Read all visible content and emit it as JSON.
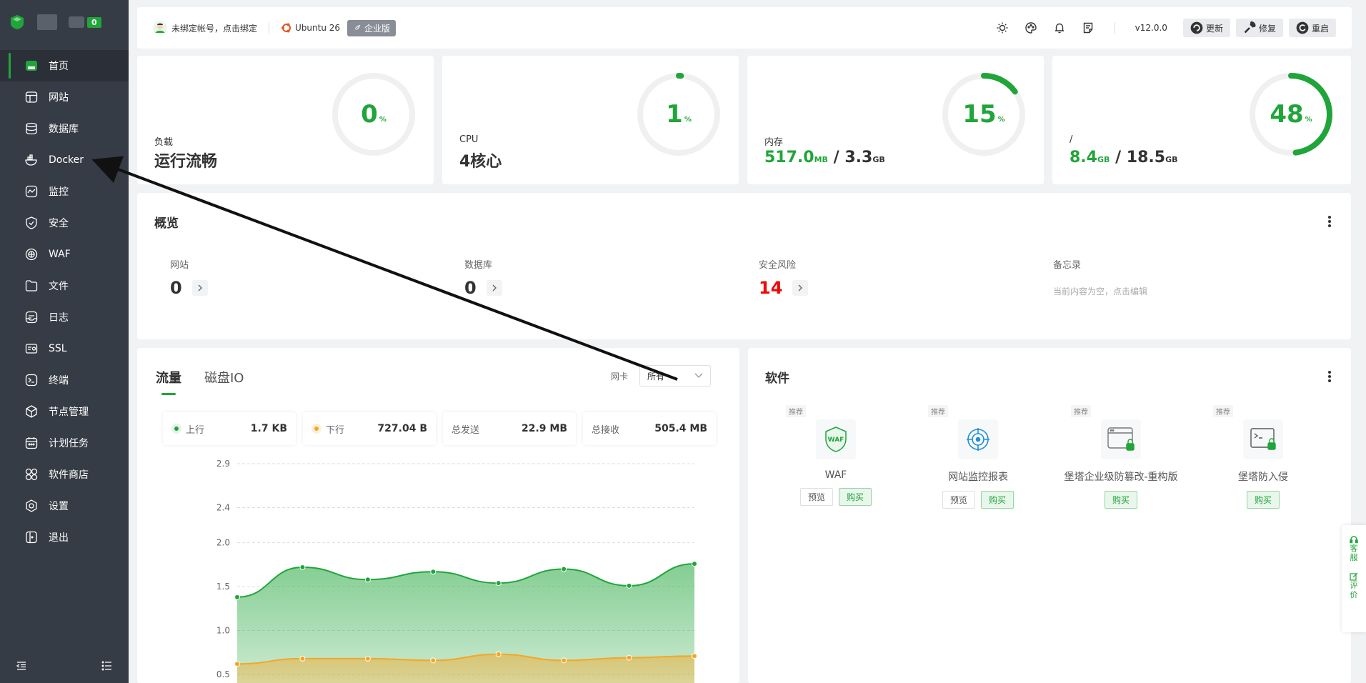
{
  "sidebar": {
    "badge": "0",
    "items": [
      {
        "label": "首页",
        "icon": "home-icon"
      },
      {
        "label": "网站",
        "icon": "website-icon"
      },
      {
        "label": "数据库",
        "icon": "database-icon"
      },
      {
        "label": "Docker",
        "icon": "docker-icon"
      },
      {
        "label": "监控",
        "icon": "monitor-icon"
      },
      {
        "label": "安全",
        "icon": "shield-icon"
      },
      {
        "label": "WAF",
        "icon": "waf-icon"
      },
      {
        "label": "文件",
        "icon": "folder-icon"
      },
      {
        "label": "日志",
        "icon": "log-icon"
      },
      {
        "label": "SSL",
        "icon": "ssl-icon"
      },
      {
        "label": "终端",
        "icon": "terminal-icon"
      },
      {
        "label": "节点管理",
        "icon": "node-icon"
      },
      {
        "label": "计划任务",
        "icon": "calendar-icon"
      },
      {
        "label": "软件商店",
        "icon": "store-icon"
      },
      {
        "label": "设置",
        "icon": "gear-icon"
      },
      {
        "label": "退出",
        "icon": "logout-icon"
      }
    ]
  },
  "topbar": {
    "account": "未绑定帐号，点击绑定",
    "os": "Ubuntu 26",
    "edition": "企业版",
    "version": "v12.0.0",
    "update": "更新",
    "repair": "修复",
    "restart": "重启"
  },
  "stats": {
    "load": {
      "label": "负载",
      "value": "运行流畅",
      "percent": 0,
      "unit": "%"
    },
    "cpu": {
      "label": "CPU",
      "value": "4核心",
      "percent": 1,
      "unit": "%"
    },
    "mem": {
      "label": "内存",
      "used": "517.0",
      "used_unit": "MB",
      "total": "3.3",
      "total_unit": "GB",
      "sep": "/",
      "percent": 15,
      "unit": "%"
    },
    "disk": {
      "label": "/",
      "used": "8.4",
      "used_unit": "GB",
      "total": "18.5",
      "total_unit": "GB",
      "sep": "/",
      "percent": 48,
      "unit": "%"
    }
  },
  "overview": {
    "title": "概览",
    "website": {
      "label": "网站",
      "value": "0"
    },
    "database": {
      "label": "数据库",
      "value": "0"
    },
    "risk": {
      "label": "安全风险",
      "value": "14"
    },
    "memo": {
      "label": "备忘录",
      "text": "当前内容为空，点击编辑"
    }
  },
  "traffic": {
    "tab_traffic": "流量",
    "tab_disk": "磁盘IO",
    "nic_label": "网卡",
    "nic_value": "所有",
    "up": {
      "label": "上行",
      "value": "1.7 KB"
    },
    "down": {
      "label": "下行",
      "value": "727.04 B"
    },
    "sent": {
      "label": "总发送",
      "value": "22.9 MB"
    },
    "recv": {
      "label": "总接收",
      "value": "505.4 MB"
    }
  },
  "chart_data": {
    "type": "area",
    "yticks": [
      "2.9",
      "2.4",
      "2.0",
      "1.5",
      "1.0",
      "0.5"
    ],
    "ylim": [
      0.5,
      2.9
    ],
    "x": [
      0,
      1,
      2,
      3,
      4,
      5,
      6,
      7
    ],
    "series": [
      {
        "name": "上行",
        "color": "#20a53a",
        "values": [
          1.38,
          1.72,
          1.58,
          1.67,
          1.54,
          1.7,
          1.51,
          1.76
        ]
      },
      {
        "name": "下行",
        "color": "#f5a623",
        "values": [
          0.62,
          0.68,
          0.68,
          0.66,
          0.73,
          0.66,
          0.69,
          0.71
        ]
      }
    ],
    "grid": true,
    "legend": "none"
  },
  "software": {
    "title": "软件",
    "rec_label": "推荐",
    "preview_label": "预览",
    "buy_label": "购买",
    "items": [
      {
        "name": "WAF",
        "has_preview": true
      },
      {
        "name": "网站监控报表",
        "has_preview": true
      },
      {
        "name": "堡塔企业级防篡改-重构版",
        "has_preview": false
      },
      {
        "name": "堡塔防入侵",
        "has_preview": false
      }
    ]
  },
  "float": {
    "service": "客服",
    "review": "评价"
  },
  "colors": {
    "accent": "#20a53a",
    "danger": "#ef0808",
    "sidebar": "#363c45",
    "download": "#f5a623"
  }
}
